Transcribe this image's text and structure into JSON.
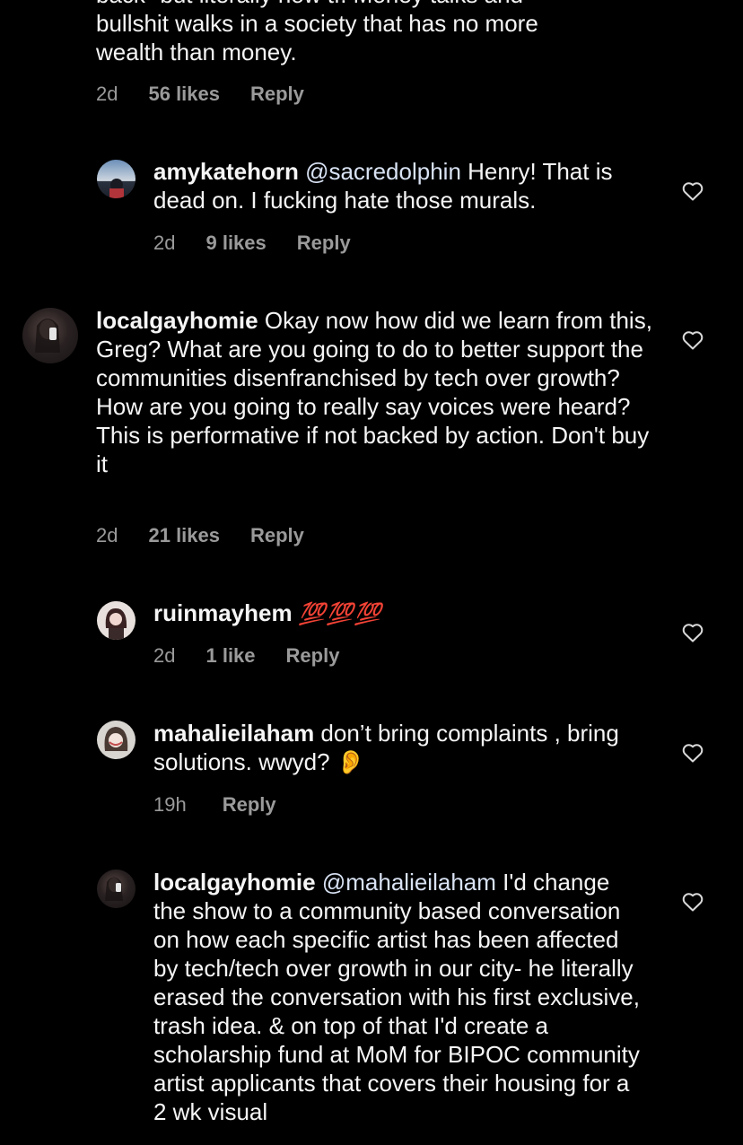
{
  "top_comment": {
    "lines": [
      "back\" but literally how tf. Money talks and",
      "bullshit walks in a society that has no more",
      "wealth than money."
    ],
    "time": "2d",
    "likes": "56 likes",
    "reply": "Reply"
  },
  "reply1": {
    "user": "amykatehorn",
    "mention": "@sacredolphin",
    "text": " Henry! That is dead on. I fucking hate those murals.",
    "time": "2d",
    "likes": "9 likes",
    "reply": "Reply"
  },
  "comment2": {
    "user": "localgayhomie",
    "text": " Okay now how did we learn from this, Greg? What are you going to do to better support the communities disenfranchised by tech over growth? How are you going to really say voices were heard? This is performative if not backed by action.  Don't buy it",
    "time": "2d",
    "likes": "21 likes",
    "reply": "Reply"
  },
  "reply2": {
    "user": "ruinmayhem",
    "text": "💯💯💯",
    "time": "2d",
    "likes": "1 like",
    "reply": "Reply"
  },
  "reply3": {
    "user": "mahalieilaham",
    "text": " don’t bring complaints , bring solutions. wwyd? 👂",
    "time": "19h",
    "reply": "Reply"
  },
  "reply4": {
    "user": "localgayhomie",
    "mention": "@mahalieilaham",
    "text": " I'd change the show to a community based conversation on how each specific artist has been affected by tech/tech over growth in our city- he literally erased the conversation with his first exclusive, trash idea. & on top of that I'd create a scholarship fund at MoM for BIPOC community artist applicants that covers their housing for a 2 wk visual"
  },
  "colors": {
    "background": "#000000",
    "meta": "#9a9a9a",
    "mention": "#d8e2f3",
    "emoji": "#e8334a"
  }
}
